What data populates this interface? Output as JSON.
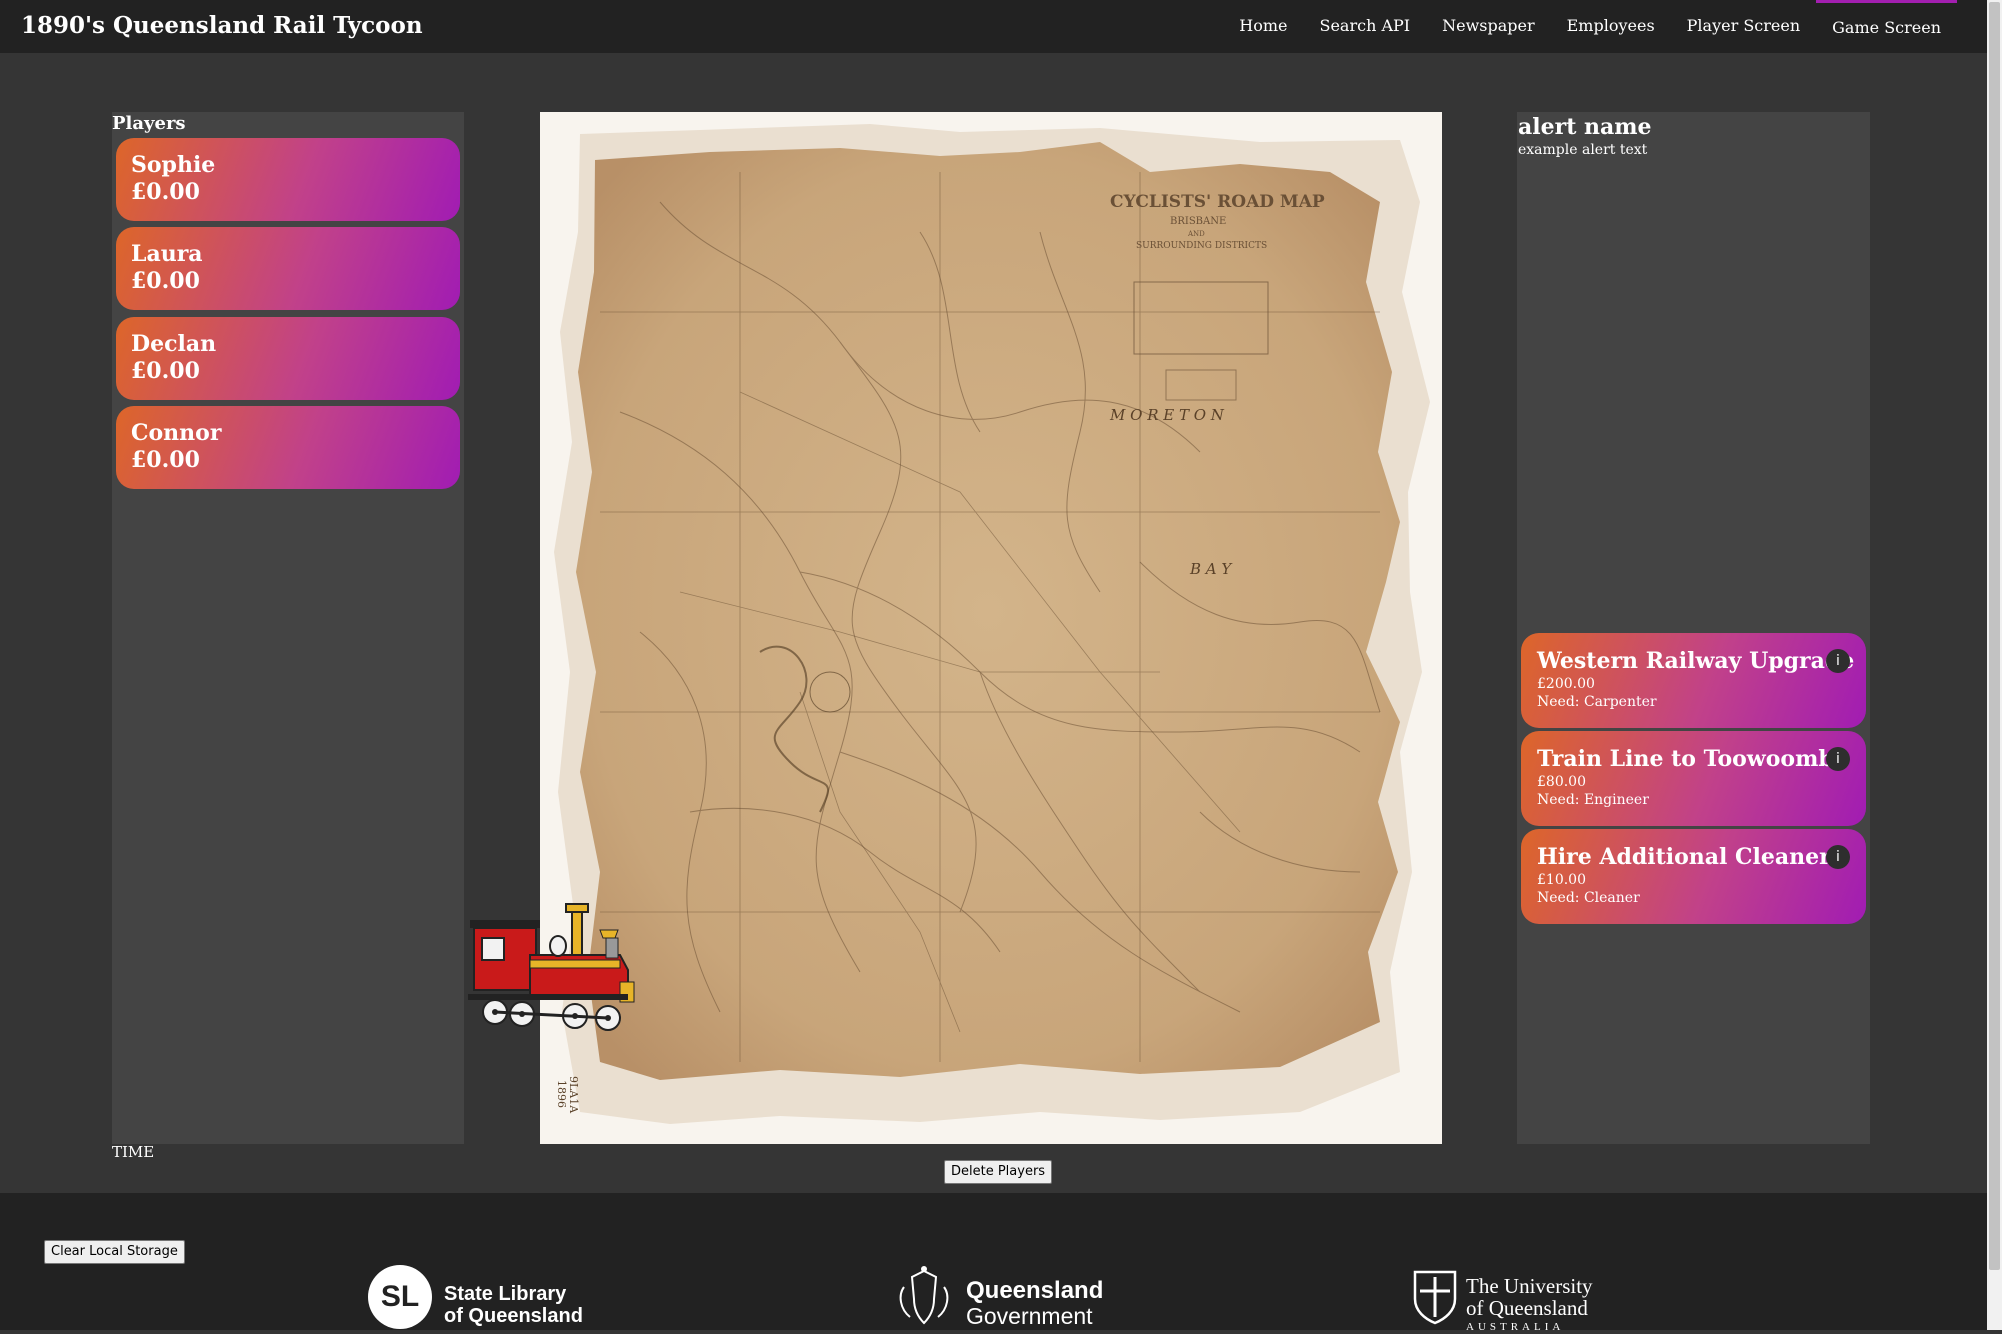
{
  "app": {
    "title": "1890's Queensland Rail Tycoon"
  },
  "nav": {
    "items": [
      {
        "label": "Home",
        "active": false
      },
      {
        "label": "Search API",
        "active": false
      },
      {
        "label": "Newspaper",
        "active": false
      },
      {
        "label": "Employees",
        "active": false
      },
      {
        "label": "Player Screen",
        "active": false
      },
      {
        "label": "Game Screen",
        "active": true
      }
    ]
  },
  "players": {
    "header": "Players",
    "list": [
      {
        "name": "Sophie",
        "money": "£0.00"
      },
      {
        "name": "Laura",
        "money": "£0.00"
      },
      {
        "name": "Declan",
        "money": "£0.00"
      },
      {
        "name": "Connor",
        "money": "£0.00"
      }
    ]
  },
  "map": {
    "title": "CYCLISTS' ROAD MAP",
    "subtitle1": "BRISBANE",
    "subtitle2": "AND",
    "subtitle3": "SURROUNDING DISTRICTS",
    "label_moreton": "M O R E T O N",
    "label_bay": "B A Y",
    "catalogue_mark": "9LA1A",
    "catalogue_year": "1896"
  },
  "alert": {
    "name": "alert name",
    "text": "example alert text"
  },
  "tasks": [
    {
      "title": "Western Railway Upgrade",
      "cost": "£200.00",
      "need": "Need: Carpenter",
      "info": "i"
    },
    {
      "title": "Train Line to Toowoomba",
      "cost": "£80.00",
      "need": "Need: Engineer",
      "info": "i"
    },
    {
      "title": "Hire Additional Cleaners",
      "cost": "£10.00",
      "need": "Need: Cleaner",
      "info": "i"
    }
  ],
  "time_label": "TIME",
  "buttons": {
    "delete_players": "Delete Players",
    "clear_storage": "Clear Local Storage"
  },
  "footer": {
    "slq": {
      "mark": "SL",
      "line1": "State Library",
      "line2": "of Queensland"
    },
    "qld": {
      "line1": "Queensland",
      "line2": "Government"
    },
    "uq": {
      "line1": "The University",
      "line2": "of Queensland",
      "line3": "AUSTRALIA"
    }
  },
  "colors": {
    "accent": "#a31fb0",
    "card_start": "#dd6629",
    "card_end": "#a11cb3",
    "panel": "#444444",
    "navbar": "#222222"
  },
  "icons": {
    "train": "steam-locomotive-icon",
    "info": "info-icon"
  }
}
